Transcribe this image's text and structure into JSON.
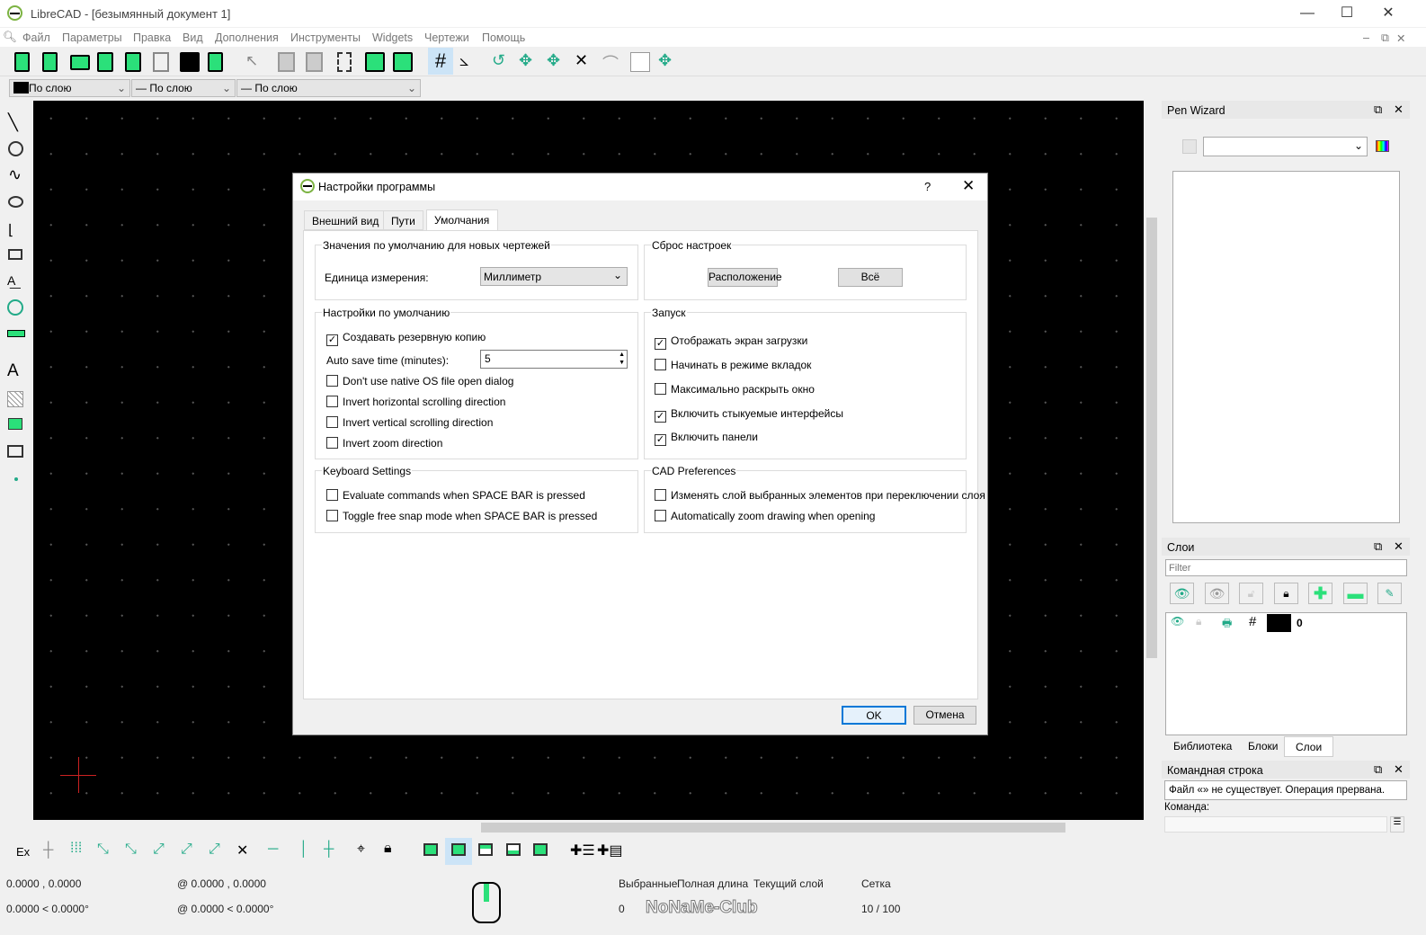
{
  "window": {
    "title": "LibreCAD - [безымянный документ 1]"
  },
  "menu": [
    "Файл",
    "Параметры",
    "Правка",
    "Вид",
    "Дополнения",
    "Инструменты",
    "Widgets",
    "Чертежи",
    "Помощь"
  ],
  "pen_toolbar": {
    "color": "По слою",
    "width": "По слою",
    "linetype": "По слою"
  },
  "dialog": {
    "title": "Настройки программы",
    "help": "?",
    "tabs": [
      "Внешний вид",
      "Пути",
      "Умолчания"
    ],
    "active_tab": "Умолчания",
    "new_drawing_defaults": {
      "title": "Значения по умолчанию для новых чертежей",
      "unit_label": "Единица измерения:",
      "unit_value": "Миллиметр"
    },
    "reset": {
      "title": "Сброс настроек",
      "layout_button": "Расположение",
      "all_button": "Всё"
    },
    "defaults": {
      "title": "Настройки по умолчанию",
      "autosave_label": "Auto save time (minutes):",
      "autosave_value": "5",
      "items": [
        {
          "label": "Создавать резервную копию",
          "checked": true
        },
        {
          "label": "Don't use native OS file open dialog",
          "checked": false
        },
        {
          "label": "Invert horizontal scrolling direction",
          "checked": false
        },
        {
          "label": "Invert vertical scrolling direction",
          "checked": false
        },
        {
          "label": "Invert zoom direction",
          "checked": false
        }
      ]
    },
    "startup": {
      "title": "Запуск",
      "items": [
        {
          "label": "Отображать экран загрузки",
          "checked": true
        },
        {
          "label": "Начинать в режиме вкладок",
          "checked": false
        },
        {
          "label": "Максимально раскрыть окно",
          "checked": false
        },
        {
          "label": "Включить стыкуемые интерфейсы",
          "checked": true
        },
        {
          "label": "Включить панели",
          "checked": true
        }
      ]
    },
    "keyboard": {
      "title": "Keyboard Settings",
      "items": [
        {
          "label": "Evaluate commands when SPACE BAR is pressed",
          "checked": false
        },
        {
          "label": "Toggle free snap mode when SPACE BAR is pressed",
          "checked": false
        }
      ]
    },
    "cad": {
      "title": "CAD Preferences",
      "items": [
        {
          "label": "Изменять слой выбранных элементов при переключении слоя",
          "checked": false
        },
        {
          "label": "Automatically zoom drawing when opening",
          "checked": false
        }
      ]
    },
    "ok": "OK",
    "cancel": "Отмена"
  },
  "pen_wizard": {
    "title": "Pen Wizard"
  },
  "layers": {
    "title": "Слои",
    "filter_placeholder": "Filter",
    "layer_name": "0",
    "tabs": [
      "Библиотека",
      "Блоки",
      "Слои"
    ],
    "active_tab": "Слои"
  },
  "command_line": {
    "title": "Командная строка",
    "message": "Файл «» не существует. Операция прервана.",
    "label": "Команда:"
  },
  "snap_toolbar": {
    "ex": "Ex"
  },
  "status": {
    "abs_cart": "0.0000 , 0.0000",
    "abs_polar": "0.0000 < 0.0000°",
    "rel_cart": "@  0.0000 , 0.0000",
    "rel_polar": "@  0.0000 < 0.0000°",
    "selected_label": "Выбранные",
    "selected_value": "0",
    "length_label": "Полная длина",
    "current_layer_label": "Текущий слой",
    "grid_label": "Сетка",
    "grid_value": "10 / 100",
    "watermark": "NoNaMe-Club"
  },
  "colors": {
    "accent": "#2be07a",
    "canvas": "#000000"
  }
}
